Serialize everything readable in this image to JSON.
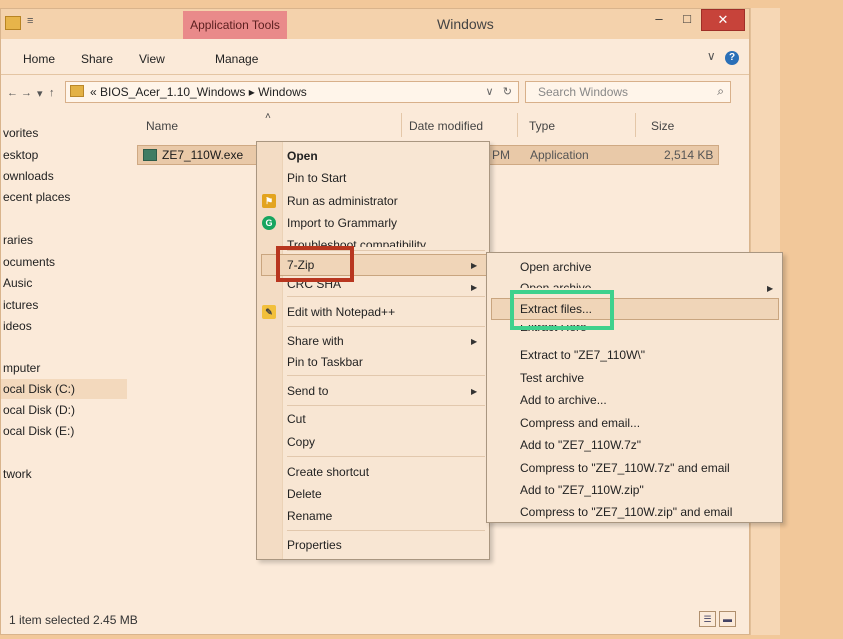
{
  "window": {
    "title": "Windows",
    "contextual_tab": "Application Tools",
    "qa_separator": "≡",
    "min_glyph": "–",
    "max_glyph": "□",
    "close_glyph": "✕"
  },
  "ribbon": {
    "tabs": [
      "Home",
      "Share",
      "View",
      "Manage"
    ],
    "expand_glyph": "∨",
    "help_glyph": "?"
  },
  "address": {
    "back_glyph": "←",
    "forward_glyph": "→",
    "up_glyph": "↑",
    "recent_glyph": "▾",
    "crumbs": "«  BIOS_Acer_1.10_Windows  ▸  Windows",
    "dropdown_glyph": "∨",
    "refresh_glyph": "↻",
    "search_placeholder": "Search Windows",
    "search_glyph": "⌕"
  },
  "nav": {
    "items": [
      "vorites",
      "esktop",
      "ownloads",
      "ecent places",
      "raries",
      "ocuments",
      "Ausic",
      "ictures",
      "ideos",
      "mputer",
      "ocal Disk (C:)",
      "ocal Disk (D:)",
      "ocal Disk (E:)",
      "twork"
    ]
  },
  "columns": {
    "name": "Name",
    "date": "Date modified",
    "type": "Type",
    "size": "Size",
    "sort_glyph": "˄"
  },
  "file": {
    "name": "ZE7_110W.exe",
    "date_fragment": "PM",
    "type": "Application",
    "size": "2,514 KB"
  },
  "status": {
    "text": "1 item selected  2.45 MB",
    "details_glyph": "☰",
    "tiles_glyph": "▬"
  },
  "context_menu": {
    "open": "Open",
    "pin_start": "Pin to Start",
    "run_admin": "Run as administrator",
    "grammarly": "Import to Grammarly",
    "troubleshoot": "Troubleshoot compatibility",
    "sevenzip": "7-Zip",
    "crc": "CRC SHA",
    "notepad": "Edit with Notepad++",
    "share_with": "Share with",
    "pin_taskbar": "Pin to Taskbar",
    "send_to": "Send to",
    "cut": "Cut",
    "copy": "Copy",
    "create_shortcut": "Create shortcut",
    "delete": "Delete",
    "rename": "Rename",
    "properties": "Properties",
    "submenu_glyph": "▶",
    "shield_glyph": "⚑",
    "grammarly_glyph": "G",
    "notepad_glyph": "✎"
  },
  "zip_menu": {
    "open_archive": "Open archive",
    "open_archive_2": "Open archive",
    "extract_files": "Extract files...",
    "extract_here": "Extract Here",
    "extract_to": "Extract to \"ZE7_110W\\\"",
    "test": "Test archive",
    "add": "Add to archive...",
    "compress_email": "Compress and email...",
    "add_7z": "Add to \"ZE7_110W.7z\"",
    "compress_7z_email": "Compress to \"ZE7_110W.7z\" and email",
    "add_zip": "Add to \"ZE7_110W.zip\"",
    "compress_zip_email": "Compress to \"ZE7_110W.zip\" and email",
    "submenu_glyph": "▶"
  },
  "colors": {
    "highlight_red": "#b8361f",
    "highlight_green": "#3ed18d",
    "close_button": "#c7433a"
  }
}
